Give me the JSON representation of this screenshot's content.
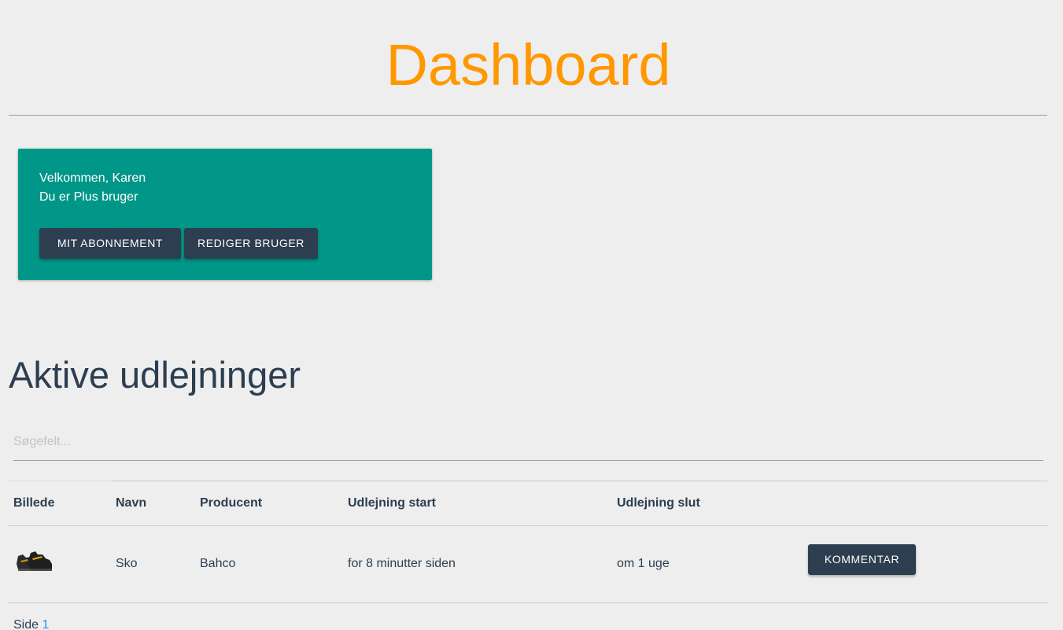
{
  "header": {
    "title": "Dashboard"
  },
  "welcome": {
    "greeting": "Velkommen, Karen",
    "tier": "Du er Plus bruger",
    "subscription_button": "MIT ABONNEMENT",
    "edit_user_button": "REDIGER BRUGER",
    "background_color": "#009688"
  },
  "rentals": {
    "title": "Aktive udlejninger",
    "search": {
      "placeholder": "Søgefelt...",
      "value": ""
    },
    "columns": [
      "Billede",
      "Navn",
      "Producent",
      "Udlejning start",
      "Udlejning slut"
    ],
    "rows": [
      {
        "image_icon": "boot-image",
        "name": "Sko",
        "producer": "Bahco",
        "start": "for 8 minutter siden",
        "end": "om 1 uge",
        "action": "KOMMENTAR"
      }
    ]
  },
  "pagination": {
    "label": "Side",
    "pages": [
      "1"
    ]
  },
  "colors": {
    "accent": "#ff9800",
    "primary_dark": "#2c3e50",
    "link": "#2196f3"
  }
}
